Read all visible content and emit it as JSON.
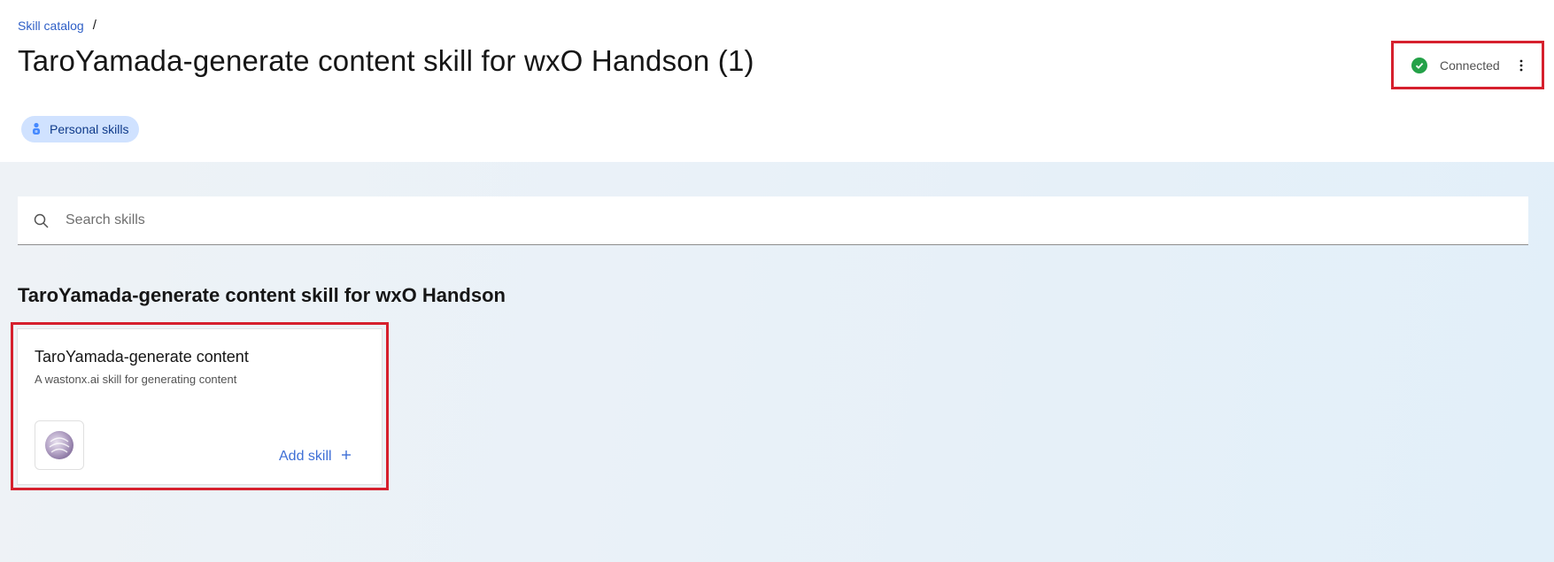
{
  "breadcrumb": {
    "link": "Skill catalog",
    "separator": "/"
  },
  "page": {
    "title": "TaroYamada-generate content skill for wxO Handson (1)"
  },
  "tag": {
    "label": "Personal skills",
    "icon": "personal-skills-icon"
  },
  "status": {
    "label": "Connected",
    "icon": "checkmark-filled-icon",
    "menu_icon": "overflow-menu-vertical-icon",
    "color": "#24a148"
  },
  "search": {
    "placeholder": "Search skills",
    "value": "",
    "icon": "search-icon"
  },
  "section": {
    "title": "TaroYamada-generate content skill for wxO Handson"
  },
  "cards": [
    {
      "title": "TaroYamada-generate content",
      "description": "A wastonx.ai skill for generating content",
      "logo_icon": "watsonx-ai-logo",
      "action_label": "Add skill",
      "action_icon": "plus-icon"
    }
  ],
  "colors": {
    "highlight": "#d6202d",
    "link": "#2f5fc6",
    "tag_bg": "#d0e2ff"
  }
}
